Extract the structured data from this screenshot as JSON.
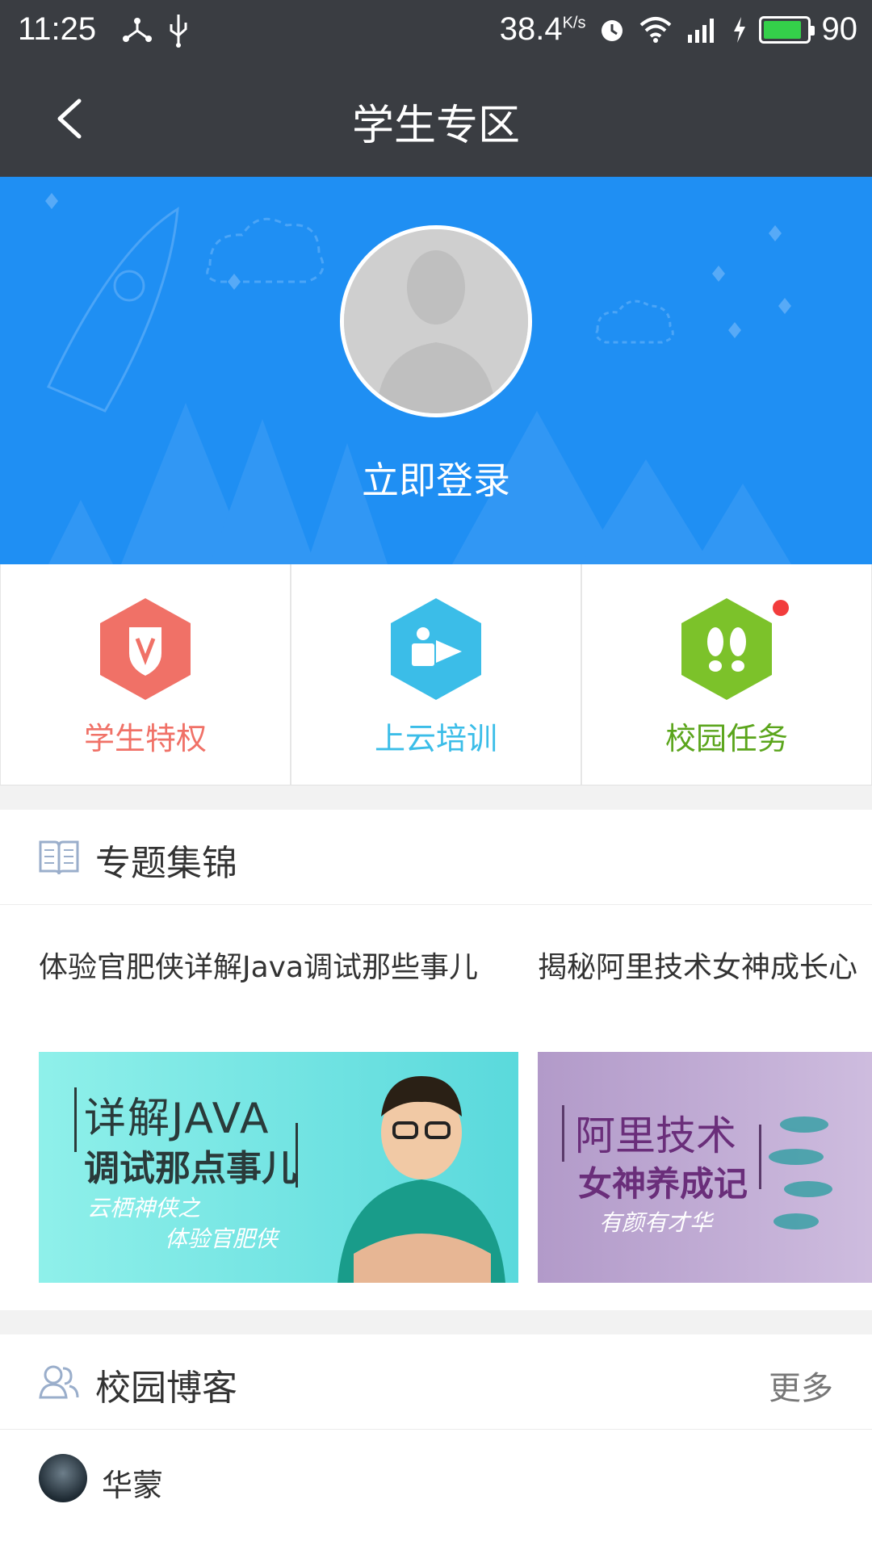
{
  "status_bar": {
    "time": "11:25",
    "speed": "38.4",
    "speed_unit": "K/s",
    "battery_level": "90",
    "icons": [
      "usb-tether-icon",
      "usb-icon",
      "alarm-icon",
      "wifi-icon",
      "signal-4g-icon",
      "charging-icon",
      "battery-icon"
    ]
  },
  "navbar": {
    "back_icon": "chevron-left-icon",
    "title": "学生专区"
  },
  "hero": {
    "login_label": "立即登录"
  },
  "quick_links": [
    {
      "label": "学生特权",
      "icon": "shield-v-icon",
      "color": "#f07167"
    },
    {
      "label": "上云培训",
      "icon": "training-video-icon",
      "color": "#3bbde8"
    },
    {
      "label": "校园任务",
      "icon": "footprints-icon",
      "color": "#7cc22a",
      "badge": true
    }
  ],
  "topics": {
    "title": "专题集锦",
    "icon": "book-icon",
    "cards": [
      {
        "title": "体验官肥侠详解Java调试那些事儿",
        "banner_lines": [
          "详解JAVA",
          "调试那点事儿",
          "云栖神侠之",
          "体验官肥侠"
        ]
      },
      {
        "title": "揭秘阿里技术女神成长心",
        "banner_lines": [
          "阿里技术",
          "女神养成记",
          "有颜有才华"
        ]
      }
    ]
  },
  "blogs": {
    "title": "校园博客",
    "icon": "users-icon",
    "more_label": "更多",
    "items": [
      {
        "author": "华蒙"
      }
    ]
  }
}
